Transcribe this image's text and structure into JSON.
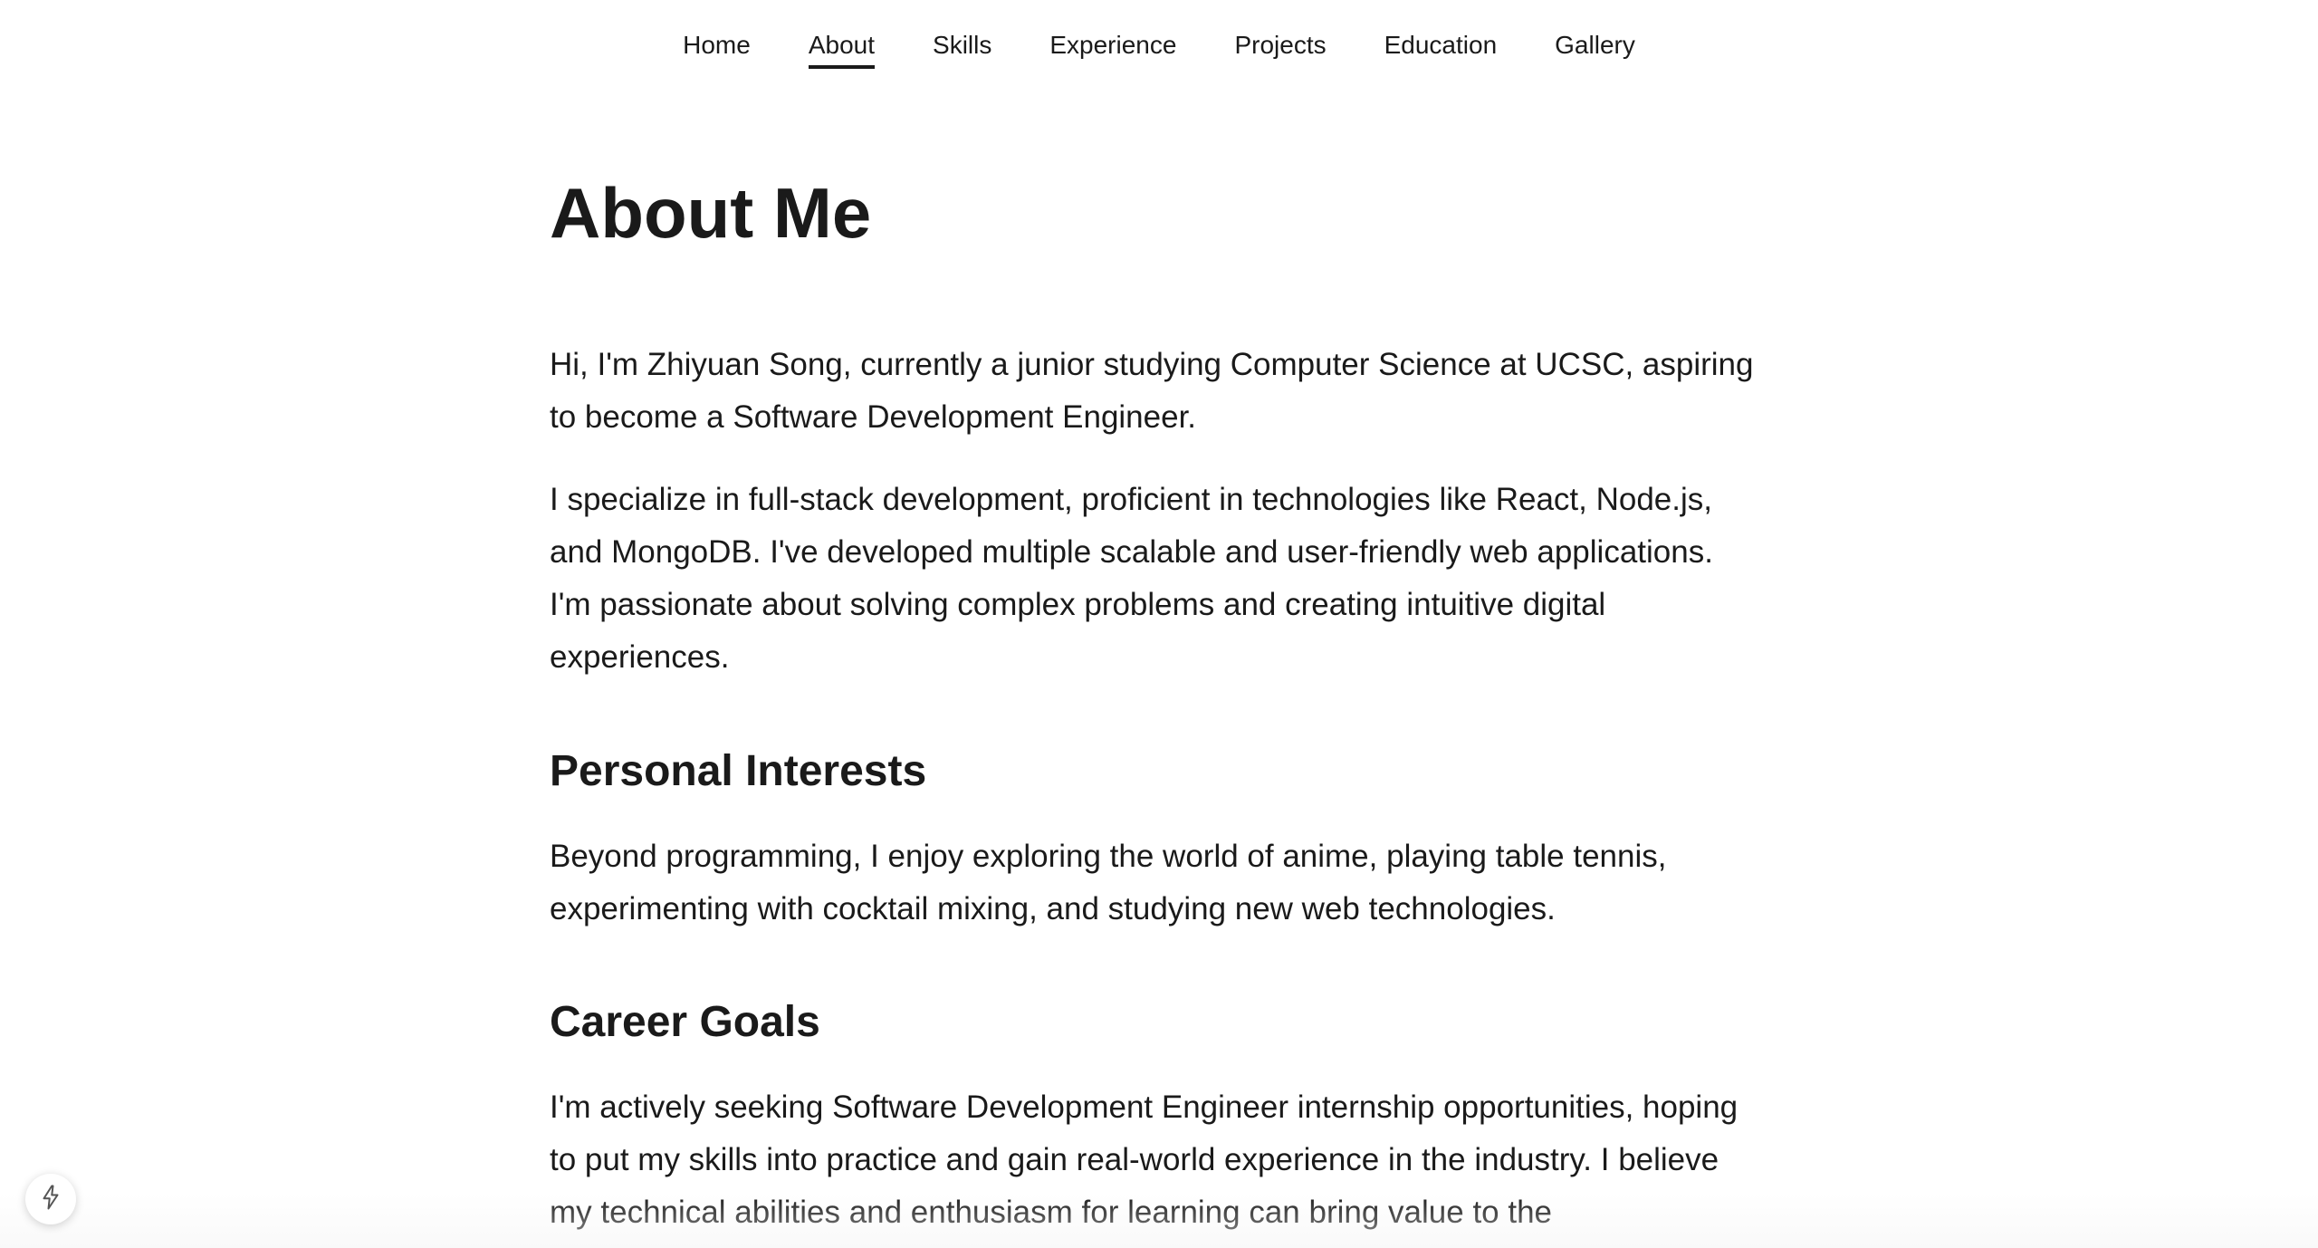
{
  "nav": {
    "items": [
      {
        "label": "Home",
        "active": false
      },
      {
        "label": "About",
        "active": true
      },
      {
        "label": "Skills",
        "active": false
      },
      {
        "label": "Experience",
        "active": false
      },
      {
        "label": "Projects",
        "active": false
      },
      {
        "label": "Education",
        "active": false
      },
      {
        "label": "Gallery",
        "active": false
      }
    ]
  },
  "page": {
    "title": "About Me",
    "intro_1": "Hi, I'm Zhiyuan Song, currently a junior studying Computer Science at UCSC, aspiring to become a Software Development Engineer.",
    "intro_2": "I specialize in full-stack development, proficient in technologies like React, Node.js, and MongoDB. I've developed multiple scalable and user-friendly web applications. I'm passionate about solving complex problems and creating intuitive digital experiences.",
    "interests_heading": "Personal Interests",
    "interests_text": "Beyond programming, I enjoy exploring the world of anime, playing table tennis, experimenting with cocktail mixing, and studying new web technologies.",
    "career_heading": "Career Goals",
    "career_text": "I'm actively seeking Software Development Engineer internship opportunities, hoping to put my skills into practice and gain real-world experience in the industry. I believe my technical abilities and enthusiasm for learning can bring value to the"
  },
  "fab": {
    "icon": "lightning-icon"
  }
}
